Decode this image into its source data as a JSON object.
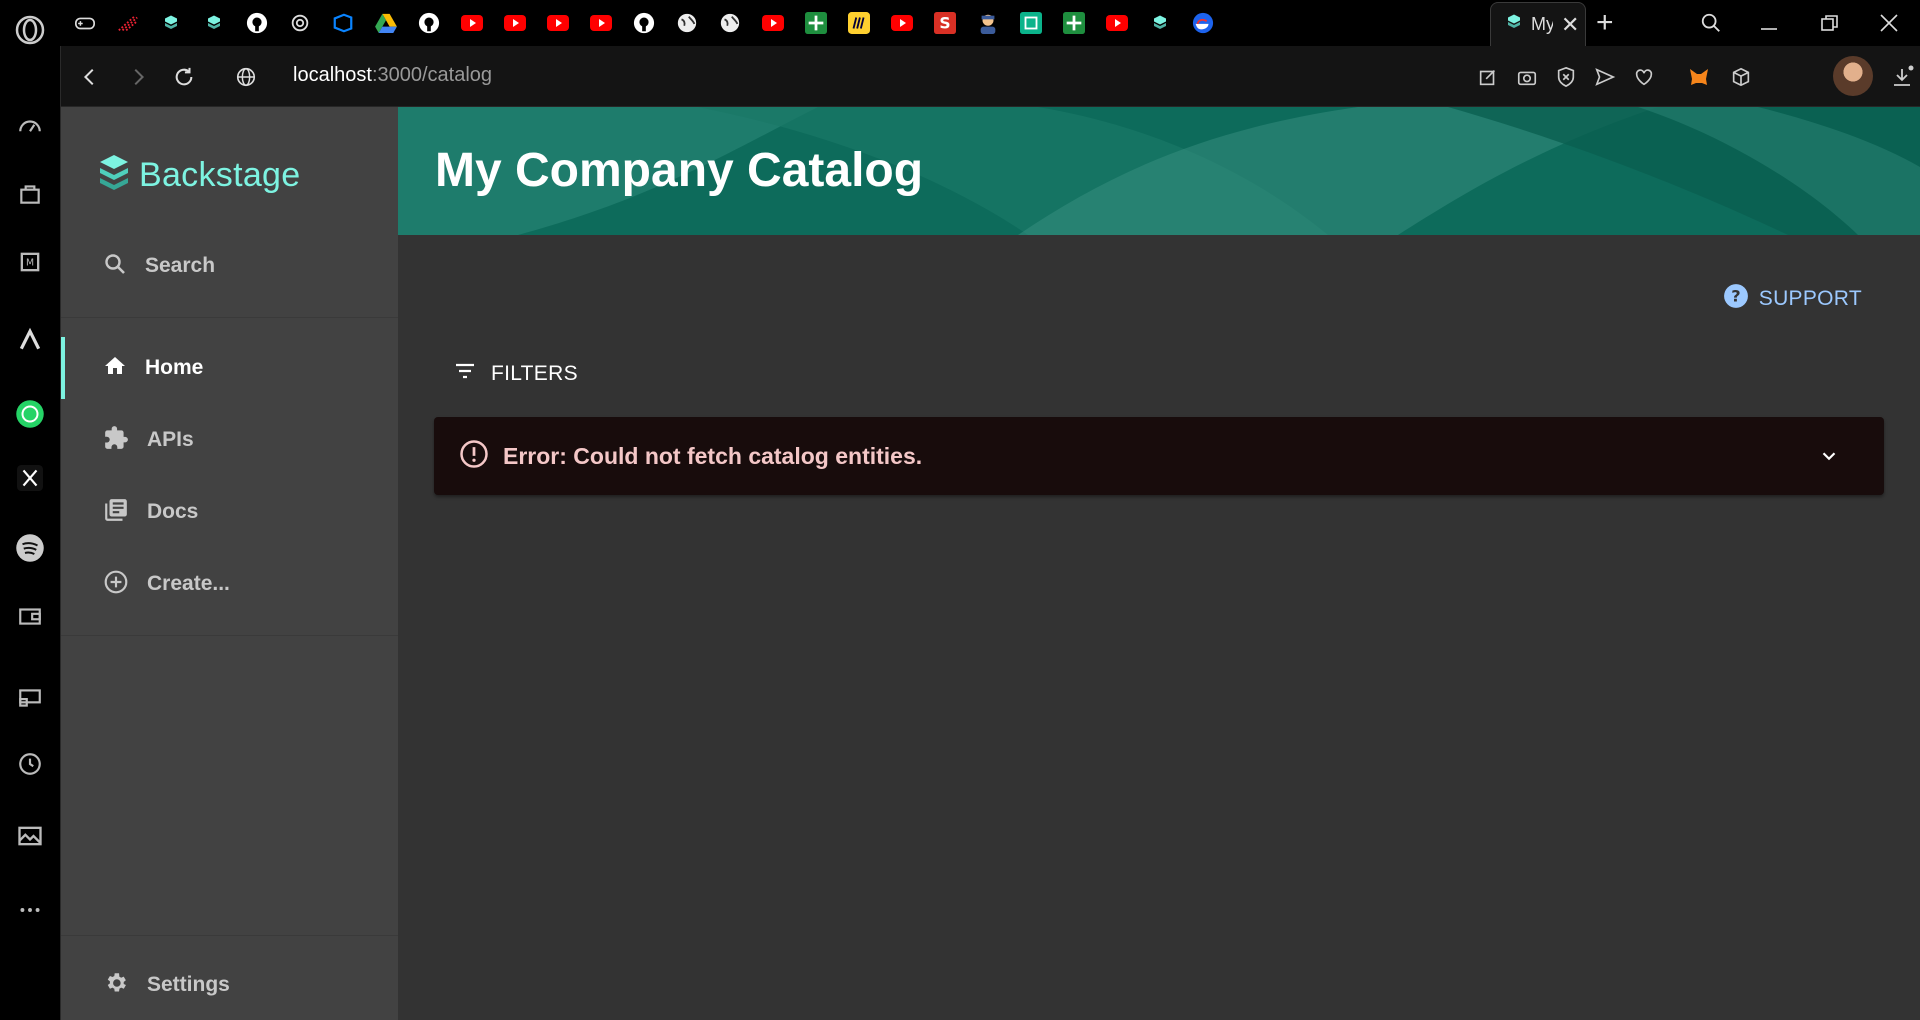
{
  "browser": {
    "address": {
      "host": "localhost",
      "path": ":3000/catalog"
    },
    "active_tab": {
      "title": "My"
    },
    "tabs": [
      {
        "icon": "gamepad-icon",
        "color": "#000000",
        "glyph": ""
      },
      {
        "icon": "red-dots-icon",
        "color": "#000000",
        "glyph": ""
      },
      {
        "icon": "backstage-icon",
        "color": "#000000",
        "glyph": ""
      },
      {
        "icon": "backstage-icon",
        "color": "#000000",
        "glyph": ""
      },
      {
        "icon": "github-icon",
        "color": "#000000",
        "glyph": ""
      },
      {
        "icon": "openai-icon",
        "color": "#000000",
        "glyph": ""
      },
      {
        "icon": "azure-devops-icon",
        "color": "#0078d4",
        "glyph": ""
      },
      {
        "icon": "google-drive-icon",
        "color": "#000000",
        "glyph": ""
      },
      {
        "icon": "github-icon",
        "color": "#000000",
        "glyph": ""
      },
      {
        "icon": "youtube-icon",
        "color": "#ff0000",
        "glyph": ""
      },
      {
        "icon": "youtube-icon",
        "color": "#ff0000",
        "glyph": ""
      },
      {
        "icon": "youtube-icon",
        "color": "#ff0000",
        "glyph": ""
      },
      {
        "icon": "youtube-icon",
        "color": "#ff0000",
        "glyph": ""
      },
      {
        "icon": "github-icon",
        "color": "#000000",
        "glyph": ""
      },
      {
        "icon": "globe-icon",
        "color": "#000000",
        "glyph": ""
      },
      {
        "icon": "globe-icon",
        "color": "#000000",
        "glyph": ""
      },
      {
        "icon": "youtube-icon",
        "color": "#ff0000",
        "glyph": ""
      },
      {
        "icon": "plus-sheet-icon",
        "color": "#1e8e3e",
        "glyph": ""
      },
      {
        "icon": "miro-icon",
        "color": "#ffd02f",
        "glyph": ""
      },
      {
        "icon": "youtube-icon",
        "color": "#ff0000",
        "glyph": ""
      },
      {
        "icon": "s-app-icon",
        "color": "#d93025",
        "glyph": ""
      },
      {
        "icon": "user-emoji-icon",
        "color": "#000000",
        "glyph": ""
      },
      {
        "icon": "codacy-icon",
        "color": "#0bb38b",
        "glyph": ""
      },
      {
        "icon": "plus-sheet-icon",
        "color": "#1e8e3e",
        "glyph": ""
      },
      {
        "icon": "youtube-icon",
        "color": "#ff0033",
        "glyph": ""
      },
      {
        "icon": "backstage-icon",
        "color": "#000000",
        "glyph": ""
      },
      {
        "icon": "docker-icon",
        "color": "#000000",
        "glyph": ""
      }
    ]
  },
  "sidebar": {
    "brand": "Backstage",
    "search_label": "Search",
    "items": [
      {
        "label": "Home",
        "icon": "home-icon"
      },
      {
        "label": "APIs",
        "icon": "puzzle-icon"
      },
      {
        "label": "Docs",
        "icon": "library-icon"
      },
      {
        "label": "Create...",
        "icon": "add-circle-icon"
      }
    ],
    "settings_label": "Settings"
  },
  "main": {
    "title": "My Company Catalog",
    "support_label": "SUPPORT",
    "filters_label": "FILTERS",
    "error_message": "Error: Could not fetch catalog entities."
  },
  "colors": {
    "accent": "#7df3e1",
    "header": "#005b4b",
    "sidebar": "#424242",
    "content": "#333333",
    "link": "#9cc9ff",
    "error_bg": "#180c0c",
    "error_text": "#f4c7c7"
  }
}
